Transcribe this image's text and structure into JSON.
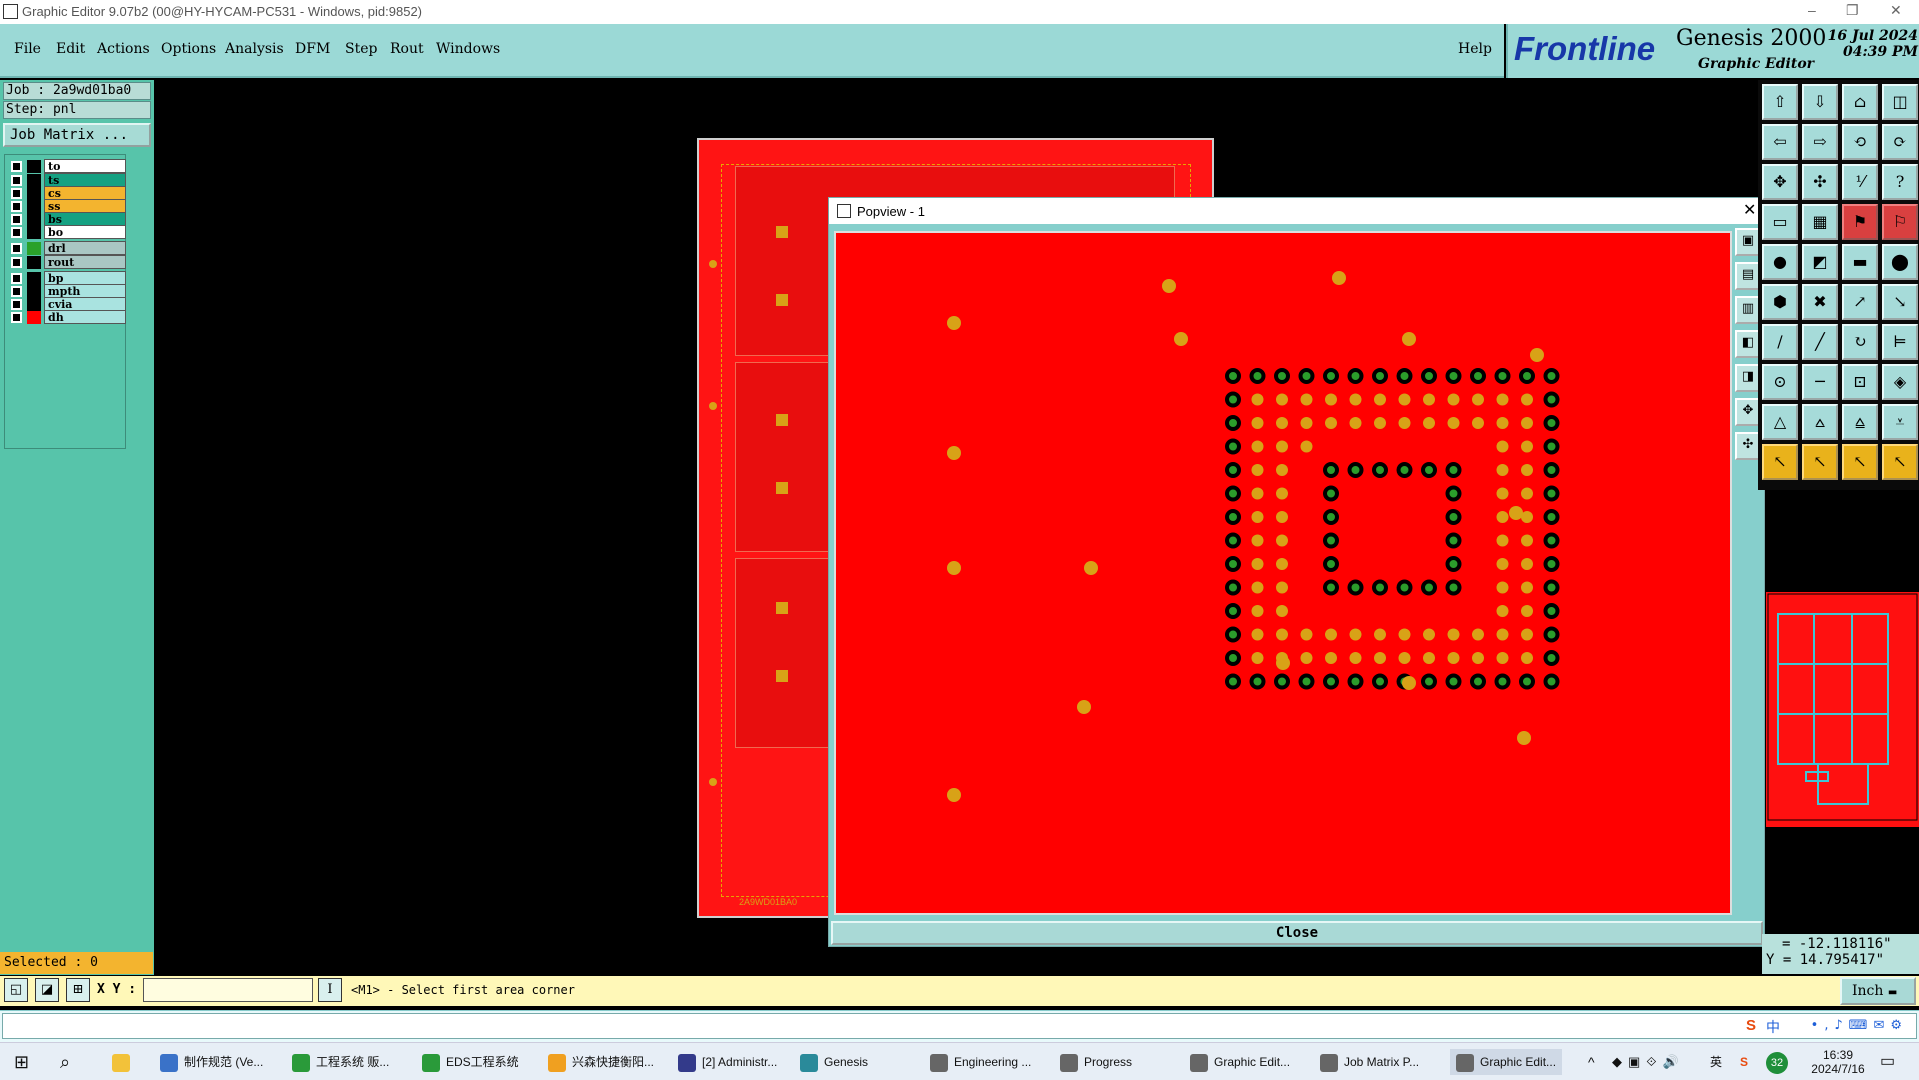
{
  "window": {
    "title": "Graphic Editor 9.07b2 (00@HY-HYCAM-PC531 - Windows, pid:9852)"
  },
  "menu": [
    "File",
    "Edit",
    "Actions",
    "Options",
    "Analysis",
    "DFM",
    "Step",
    "Rout",
    "Windows"
  ],
  "help": "Help",
  "brand": {
    "logo": "Frontline",
    "product": "Genesis 2000",
    "subtitle": "Graphic Editor",
    "date": "16 Jul 2024",
    "time": "04:39 PM"
  },
  "job": {
    "job_label": "Job : 2a9wd01ba0",
    "step_label": "Step: pnl",
    "matrix_button": "Job Matrix ..."
  },
  "layers": [
    {
      "name": "to",
      "color": "#ffffff",
      "swatch": "#000000"
    },
    {
      "name": "ts",
      "color": "#15a182",
      "swatch": "#000000"
    },
    {
      "name": "cs",
      "color": "#f3b42f",
      "swatch": "#000000"
    },
    {
      "name": "ss",
      "color": "#f3b42f",
      "swatch": "#000000"
    },
    {
      "name": "bs",
      "color": "#15a182",
      "swatch": "#000000"
    },
    {
      "name": "bo",
      "color": "#ffffff",
      "swatch": "#000000"
    },
    {
      "name": "drl",
      "color": "#a9c7c4",
      "swatch": "#2aa12a"
    },
    {
      "name": "rout",
      "color": "#a9c7c4",
      "swatch": "#000000"
    },
    {
      "name": "bp",
      "color": "#a9e3e0",
      "swatch": "#000000"
    },
    {
      "name": "mpth",
      "color": "#a9e3e0",
      "swatch": "#000000"
    },
    {
      "name": "cvia",
      "color": "#a9e3e0",
      "swatch": "#000000"
    },
    {
      "name": "dh",
      "color": "#a9e3e0",
      "swatch": "#ff0000"
    }
  ],
  "selected": "Selected : 0",
  "popview": {
    "title": "Popview - 1",
    "close": "Close"
  },
  "coords": {
    "x": "= -12.118116\"",
    "y": "Y = 14.795417\""
  },
  "cmd": {
    "xy_label": "X Y :",
    "xy_value": "",
    "prompt": "<M1> - Select first area corner",
    "unit": "Inch"
  },
  "board": {
    "label": "2A9WD01BA0"
  },
  "taskbar": {
    "items": [
      "制作规范 (Ve...",
      "工程系统  贩...",
      "EDS工程系统",
      "兴森快捷衡阳...",
      "[2] Administr...",
      "Genesis",
      "Engineering ...",
      "Progress",
      "Graphic Edit...",
      "Job Matrix P...",
      "Graphic Edit..."
    ],
    "tray": {
      "lang": "英",
      "badge": "32",
      "time": "16:39",
      "date": "2024/7/16",
      "ime": "中"
    }
  },
  "colors": {
    "copper": "#ff0000",
    "pad": "#d8a217",
    "menu_bg": "#9bd9d6",
    "panel_bg": "#57c4aa",
    "hole": "#2b9d2b"
  }
}
